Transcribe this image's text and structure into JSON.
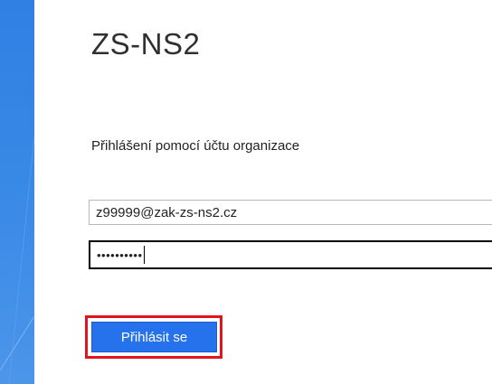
{
  "server_title": "ZS-NS2",
  "subtitle": "Přihlášení pomocí účtu organizace",
  "form": {
    "username_value": "z99999@zak-zs-ns2.cz",
    "password_value": "••••••••••"
  },
  "login_button_label": "Přihlásit se",
  "colors": {
    "accent_blue": "#2672ec",
    "side_strip": "#2f80e3",
    "highlight_red": "#e0161f"
  }
}
